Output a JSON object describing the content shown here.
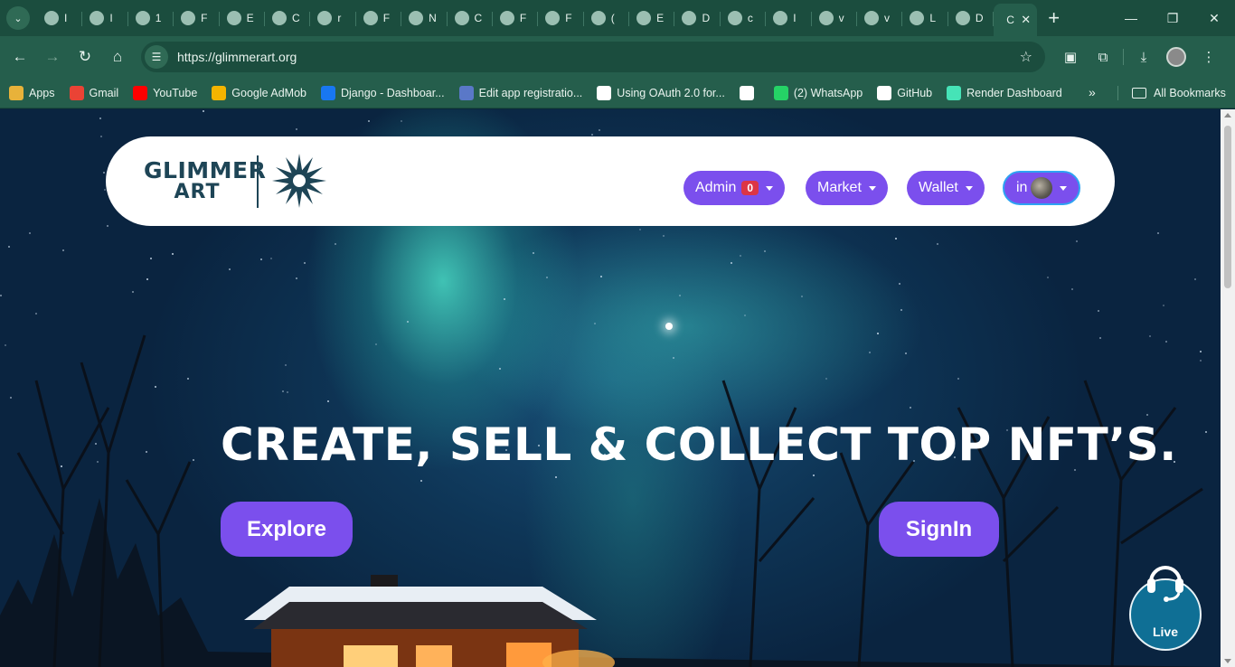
{
  "browser": {
    "tabs": [
      {
        "icon": "globe-icon",
        "text": "I"
      },
      {
        "icon": "flag-icon",
        "text": "I"
      },
      {
        "icon": "app-icon",
        "text": "1"
      },
      {
        "icon": "app-icon",
        "text": "F"
      },
      {
        "icon": "github-icon",
        "text": "E"
      },
      {
        "icon": "dashboard-icon",
        "text": "C"
      },
      {
        "icon": "app-icon",
        "text": "r"
      },
      {
        "icon": "openai-icon",
        "text": "F"
      },
      {
        "icon": "globe-icon",
        "text": "N"
      },
      {
        "icon": "sparkle-icon",
        "text": "C"
      },
      {
        "icon": "flag-icon",
        "text": "F"
      },
      {
        "icon": "link-icon",
        "text": "F"
      },
      {
        "icon": "whatsapp-icon",
        "text": "("
      },
      {
        "icon": "app-icon",
        "text": "E"
      },
      {
        "icon": "doc-icon",
        "text": "D"
      },
      {
        "icon": "link-icon",
        "text": "c"
      },
      {
        "icon": "app-icon",
        "text": "I"
      },
      {
        "icon": "app-icon",
        "text": "v"
      },
      {
        "icon": "loading-icon",
        "text": "v"
      },
      {
        "icon": "play-icon",
        "text": "L"
      },
      {
        "icon": "camera-icon",
        "text": "D"
      }
    ],
    "active_tab_text": "C",
    "url": "https://glimmerart.org",
    "bookmarks": [
      {
        "label": "Apps",
        "icon": "apps-icon",
        "color": "#e8b23a"
      },
      {
        "label": "Gmail",
        "icon": "gmail-icon",
        "color": "#ea4335"
      },
      {
        "label": "YouTube",
        "icon": "youtube-icon",
        "color": "#ff0000"
      },
      {
        "label": "Google AdMob",
        "icon": "admob-icon",
        "color": "#f4b400"
      },
      {
        "label": "Django - Dashboar...",
        "icon": "facebook-icon",
        "color": "#1877f2"
      },
      {
        "label": "Edit app registratio...",
        "icon": "api-icon",
        "color": "#5a78c8"
      },
      {
        "label": "Using OAuth 2.0 for...",
        "icon": "google-icon",
        "color": "#ffffff"
      },
      {
        "label": "",
        "icon": "globe-icon",
        "color": "#ffffff"
      },
      {
        "label": "(2) WhatsApp",
        "icon": "whatsapp-icon",
        "color": "#25d366"
      },
      {
        "label": "GitHub",
        "icon": "github-icon",
        "color": "#ffffff"
      },
      {
        "label": "Render Dashboard",
        "icon": "render-icon",
        "color": "#46e3b7"
      }
    ],
    "all_bookmarks": "All Bookmarks"
  },
  "site": {
    "logo": {
      "line1": "GLIMMER",
      "line2": "ART"
    },
    "nav": {
      "admin": "Admin",
      "admin_badge": "0",
      "market": "Market",
      "wallet": "Wallet",
      "profile": "in"
    },
    "hero": {
      "title": "CREATE, SELL & COLLECT TOP NFT’S.",
      "explore": "Explore",
      "signin": "SignIn"
    },
    "live_chat": "Live"
  },
  "colors": {
    "accent": "#7b4fed",
    "chrome": "#255e4c",
    "badge": "#dc3545",
    "live": "#0f6f95"
  }
}
